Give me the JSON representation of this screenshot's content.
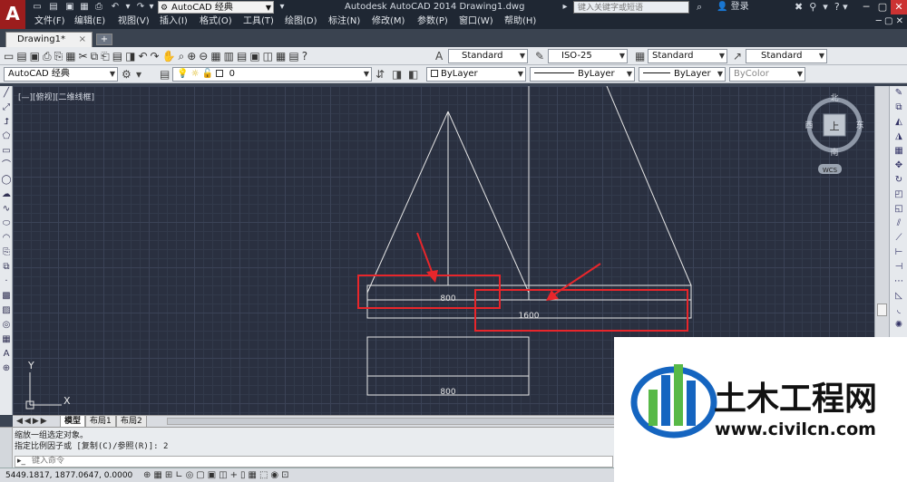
{
  "titlebar": {
    "logo_letter": "A",
    "workspace": "AutoCAD 经典",
    "window_title": "Autodesk AutoCAD 2014    Drawing1.dwg",
    "search_placeholder": "键入关键字或短语",
    "login": "登录"
  },
  "menu": {
    "items": [
      "文件(F)",
      "编辑(E)",
      "视图(V)",
      "插入(I)",
      "格式(O)",
      "工具(T)",
      "绘图(D)",
      "标注(N)",
      "修改(M)",
      "参数(P)",
      "窗口(W)",
      "帮助(H)"
    ]
  },
  "tabs": {
    "drawing_tab": "Drawing1*",
    "close_glyph": "×",
    "new_tab_glyph": "+"
  },
  "toolbar": {
    "text_style": "Standard",
    "dim_style": "ISO-25",
    "table_style": "Standard",
    "multileader_style": "Standard",
    "workspace": "AutoCAD 经典",
    "layer": "0",
    "color": "ByLayer",
    "linetype": "ByLayer",
    "lineweight": "ByLayer",
    "plot_style": "ByColor"
  },
  "viewport": {
    "view_label": "[—][俯视][二维线框]",
    "dim_top": "800",
    "dim_top_wide": "1600",
    "dim_bottom": "800",
    "ucs_x": "X",
    "ucs_y": "Y"
  },
  "viewcube": {
    "north": "北",
    "south": "南",
    "east": "东",
    "west": "西",
    "top": "上",
    "wcs": "WCS"
  },
  "layout_tabs": {
    "nav": "◀◀▶▶",
    "model": "模型",
    "layout1": "布局1",
    "layout2": "布局2"
  },
  "command": {
    "line1": "缩放一组选定对象。",
    "line2": "指定比例因子或 [复制(C)/参照(R)]: 2",
    "input_placeholder": "键入命令"
  },
  "status": {
    "coords": "5449.1817, 1877.0647, 0.0000"
  },
  "watermark": {
    "name": "土木工程网",
    "url": "www.civilcn.com"
  },
  "colors": {
    "annotation_red": "#e8262b",
    "canvas_bg": "#2a3040",
    "line_white": "#e6e6e6",
    "watermark_blue": "#1565c0",
    "watermark_green": "#58b947"
  }
}
